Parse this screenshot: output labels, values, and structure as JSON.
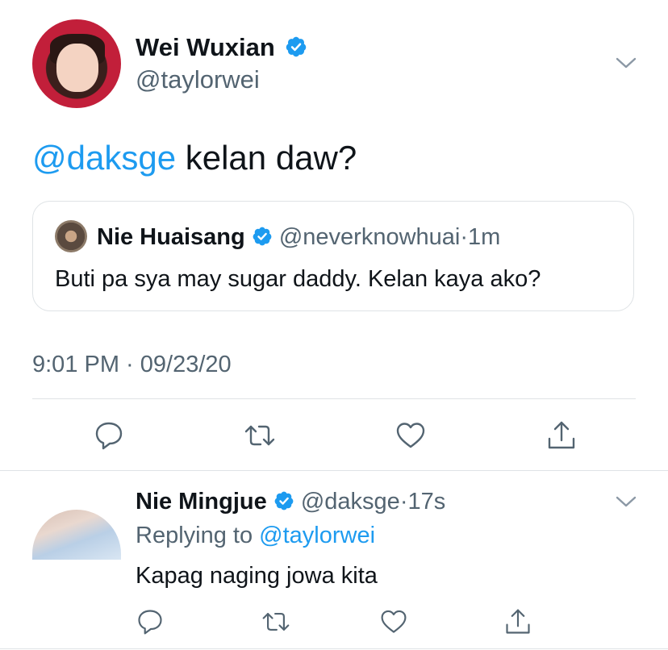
{
  "main_tweet": {
    "author_name": "Wei Wuxian",
    "author_handle": "@taylorwei",
    "mention": "@daksge",
    "text": " kelan daw?",
    "timestamp": "9:01 PM · 09/23/20",
    "avatar_icon": "profile-photo",
    "menu_icon": "chevron-down-icon"
  },
  "quoted_tweet": {
    "author_name": "Nie Huaisang",
    "author_handle": "@neverknowhuai",
    "separator": "·",
    "time": "1m",
    "text": "Buti pa sya may sugar daddy. Kelan kaya ako?"
  },
  "reply_tweet": {
    "author_name": "Nie Mingjue",
    "author_handle": "@daksge",
    "separator": "·",
    "time": "17s",
    "replying_prefix": "Replying to ",
    "replying_handle": "@taylorwei",
    "text": "Kapag naging jowa kita"
  },
  "actions": [
    "reply-icon",
    "retweet-icon",
    "like-icon",
    "share-icon"
  ],
  "colors": {
    "accent": "#1d9bf0",
    "secondary_text": "#536471",
    "border": "#dfe3e6"
  }
}
